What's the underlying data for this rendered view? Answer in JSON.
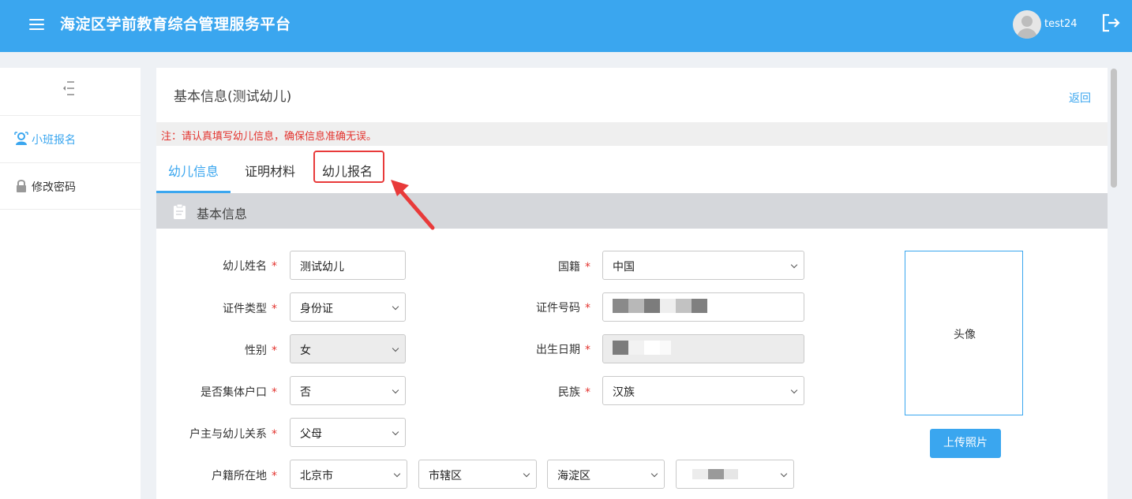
{
  "header": {
    "app_title": "海淀区学前教育综合管理服务平台",
    "username": "test24"
  },
  "sidebar": {
    "items": [
      {
        "label": "小班报名",
        "active": true
      },
      {
        "label": "修改密码",
        "active": false
      }
    ]
  },
  "main": {
    "page_title": "基本信息(测试幼儿)",
    "back_label": "返回",
    "notice": "注：请认真填写幼儿信息，确保信息准确无误。",
    "tabs": [
      {
        "label": "幼儿信息"
      },
      {
        "label": "证明材料"
      },
      {
        "label": "幼儿报名"
      }
    ],
    "section_title": "基本信息",
    "fields": {
      "name": {
        "label": "幼儿姓名",
        "value": "测试幼儿"
      },
      "nationality": {
        "label": "国籍",
        "value": "中国"
      },
      "id_type": {
        "label": "证件类型",
        "value": "身份证"
      },
      "id_number": {
        "label": "证件号码"
      },
      "gender": {
        "label": "性别",
        "value": "女"
      },
      "birth_date": {
        "label": "出生日期"
      },
      "collective": {
        "label": "是否集体户口",
        "value": "否"
      },
      "ethnicity": {
        "label": "民族",
        "value": "汉族"
      },
      "relation": {
        "label": "户主与幼儿关系",
        "value": "父母"
      },
      "household": {
        "label": "户籍所在地",
        "province": "北京市",
        "city": "市辖区",
        "district": "海淀区"
      }
    },
    "photo_label": "头像",
    "upload_label": "上传照片"
  },
  "colors": {
    "brand": "#3aa6ef",
    "required": "#e3342f",
    "highlight": "#e83a3a"
  }
}
